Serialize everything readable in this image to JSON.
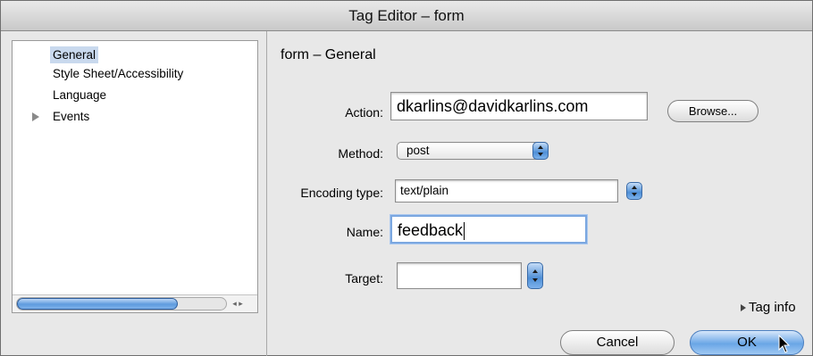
{
  "window": {
    "title": "Tag Editor – form"
  },
  "categories": [
    {
      "label": "General",
      "selected": true
    },
    {
      "label": "Style Sheet/Accessibility"
    },
    {
      "label": "Language"
    },
    {
      "label": "Events",
      "expandable": true
    }
  ],
  "section_title": "form – General",
  "fields": {
    "action": {
      "label": "Action:",
      "value": "dkarlins@davidkarlins.com"
    },
    "browse_button": "Browse...",
    "method": {
      "label": "Method:",
      "value": "post"
    },
    "encoding": {
      "label": "Encoding type:",
      "value": "text/plain"
    },
    "name": {
      "label": "Name:",
      "value": "feedback"
    },
    "target": {
      "label": "Target:",
      "value": ""
    }
  },
  "tag_info": "Tag info",
  "buttons": {
    "cancel": "Cancel",
    "ok": "OK"
  }
}
